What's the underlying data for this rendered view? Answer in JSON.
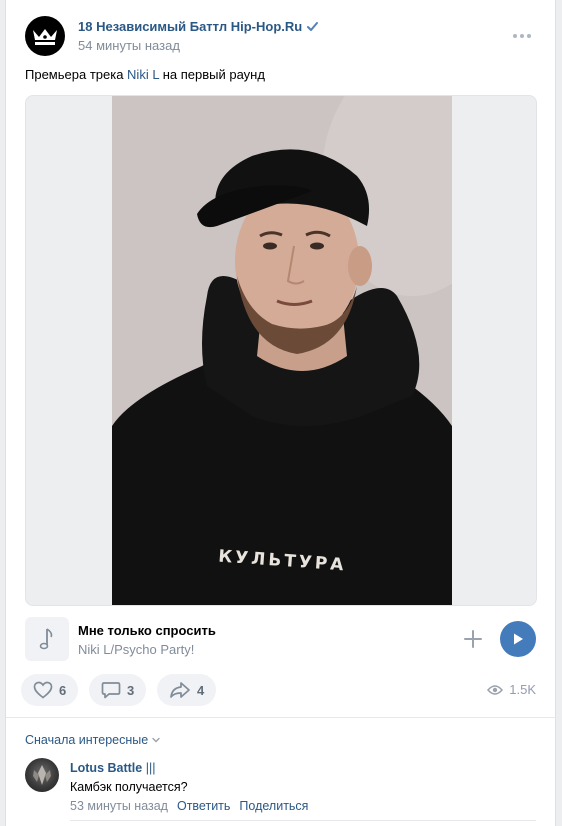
{
  "post": {
    "group_name": "18 Независимый Баттл Hip-Hop.Ru",
    "time": "54 минуты назад",
    "text_before": "Премьера трека ",
    "text_link": "Niki L",
    "text_after": " на первый раунд",
    "photo_caption": "КУЛЬТУРА"
  },
  "audio": {
    "title": "Мне только спросить",
    "artist": "Niki L/Psycho Party!"
  },
  "actions": {
    "likes": "6",
    "comments": "3",
    "shares": "4",
    "views": "1.5K"
  },
  "comments": {
    "sort_label": "Сначала интересные",
    "items": [
      {
        "author": "Lotus Battle",
        "author_suffix": "|||",
        "text": "Камбэк получается?",
        "time": "53 минуты назад",
        "reply": "Ответить",
        "share": "Поделиться"
      }
    ]
  },
  "colors": {
    "link": "#2a5885",
    "secondary": "#818c99",
    "play_button": "#447bba",
    "pill_bg": "#f0f2f5"
  }
}
